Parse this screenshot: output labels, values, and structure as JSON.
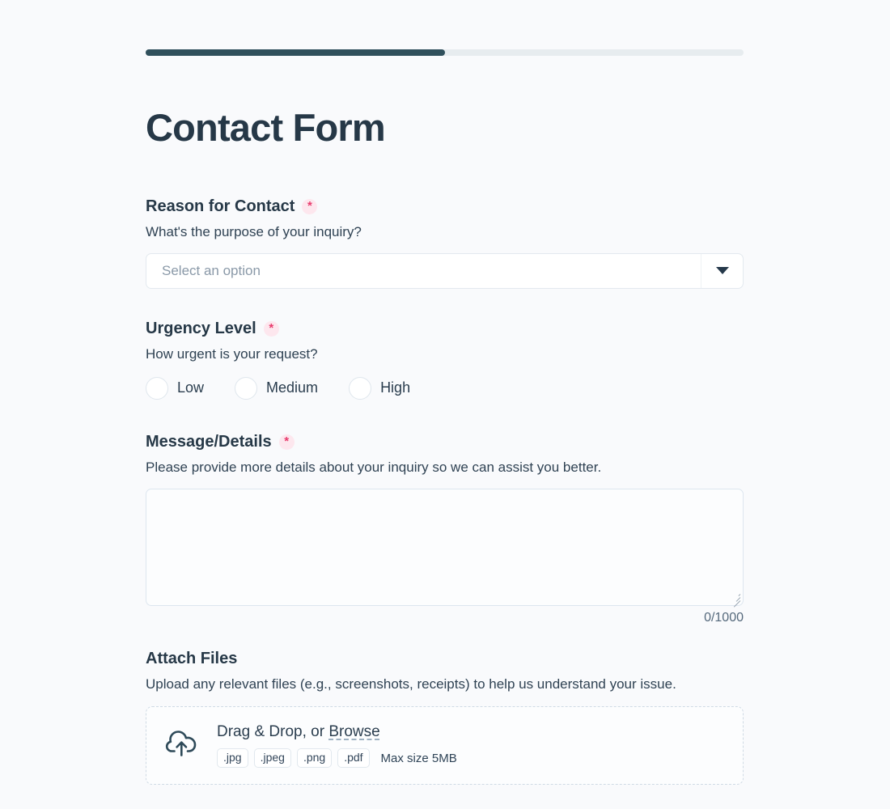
{
  "progress": {
    "percent": 50,
    "fill_color": "#30505c",
    "track_color": "#e7ecef"
  },
  "header": {
    "title": "Contact Form"
  },
  "required_marker": "*",
  "fields": {
    "reason": {
      "label": "Reason for Contact",
      "help": "What's the purpose of your inquiry?",
      "placeholder": "Select an option"
    },
    "urgency": {
      "label": "Urgency Level",
      "help": "How urgent is your request?",
      "options": [
        {
          "label": "Low"
        },
        {
          "label": "Medium"
        },
        {
          "label": "High"
        }
      ]
    },
    "message": {
      "label": "Message/Details",
      "help": "Please provide more details about your inquiry so we can assist you better.",
      "value": "",
      "counter": "0/1000"
    },
    "attachments": {
      "label": "Attach Files",
      "help": "Upload any relevant files (e.g., screenshots, receipts) to help us understand your issue.",
      "drop_prefix": "Drag & Drop, or ",
      "browse_label": "Browse",
      "accepted": [
        ".jpg",
        ".jpeg",
        ".png",
        ".pdf"
      ],
      "max_size": "Max size 5MB"
    }
  },
  "colors": {
    "page_background": "#f9fafc",
    "text_primary": "#263847",
    "required_asterisk": "#e83b6d",
    "required_badge_bg": "#fde7ee"
  }
}
